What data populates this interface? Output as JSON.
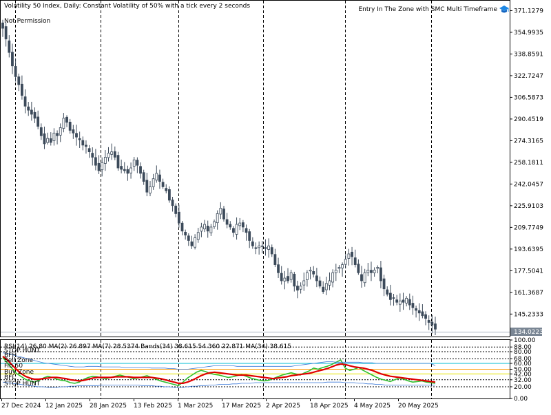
{
  "chart_title": "Volatility 50 Index, Daily:  Constant Volatility of 50% with a tick every 2 seconds",
  "permission_text": "Not Permission",
  "ea_name": "Entry In The Zone with SMC Multi Timeframe",
  "ea_icon": "graduation-cap-icon",
  "colors": {
    "candle": "#3c4a5a",
    "rsi_green": "#2fbf2f",
    "rsi_red": "#e00000",
    "band_blue": "#3a78d8",
    "zone_orange": "#ff9a00",
    "zone_yellow": "#e6e600",
    "level_cyan": "#00bcd4",
    "grid": "#000000"
  },
  "chart_data": [
    {
      "type": "candlestick",
      "y_ticks": [
        "371.1279",
        "354.9935",
        "338.8591",
        "322.7247",
        "306.5873",
        "290.4519",
        "274.3165",
        "258.1811",
        "242.0457",
        "225.9103",
        "209.7749",
        "193.6395",
        "177.5041",
        "161.3687",
        "145.2333"
      ],
      "current_price": "134.0223",
      "ylim": [
        129,
        377
      ],
      "x_labels": [
        "27 Dec 2024",
        "12 Jan 2025",
        "28 Jan 2025",
        "13 Feb 2025",
        "1 Mar 2025",
        "17 Mar 2025",
        "2 Apr 2025",
        "18 Apr 2025",
        "4 May 2025",
        "20 May 2025"
      ],
      "closes": [
        358,
        350,
        340,
        330,
        322,
        316,
        308,
        300,
        297,
        294,
        291,
        285,
        278,
        272,
        276,
        273,
        280,
        278,
        284,
        291,
        288,
        282,
        280,
        277,
        275,
        271,
        270,
        266,
        262,
        256,
        252,
        258,
        262,
        265,
        266,
        262,
        254,
        253,
        252,
        250,
        254,
        260,
        256,
        250,
        244,
        236,
        240,
        246,
        250,
        244,
        240,
        237,
        230,
        226,
        220,
        213,
        207,
        204,
        200,
        196,
        202,
        206,
        210,
        212,
        207,
        210,
        214,
        220,
        224,
        216,
        212,
        210,
        206,
        212,
        213,
        210,
        206,
        200,
        196,
        194,
        196,
        196,
        194,
        196,
        190,
        182,
        176,
        170,
        172,
        170,
        176,
        166,
        163,
        166,
        170,
        176,
        178,
        175,
        170,
        166,
        162,
        168,
        170,
        176,
        178,
        180,
        182,
        186,
        190,
        188,
        182,
        176,
        170,
        176,
        178,
        176,
        178,
        180,
        170,
        164,
        160,
        156,
        157,
        154,
        155,
        154,
        157,
        152,
        150,
        148,
        146,
        144,
        142,
        139,
        137,
        134
      ]
    },
    {
      "type": "line",
      "legend": "RSI(14) 26.80 MA(2) 26.897 MA(7) 28.5374 Bands(34) 38.615 54.360 22.871 MA(34) 38.615",
      "y_ticks": [
        "100.00",
        "88.00",
        "80.00",
        "68.00",
        "60.00",
        "50.00",
        "42.00",
        "32.00",
        "20.00",
        "0.00"
      ],
      "ylim": [
        0,
        100
      ],
      "zone_labels": [
        "STOP HUNT",
        "BFH",
        "Sell Zone",
        "Fib 50",
        "Buy Zone",
        "BFL",
        "STOP HUNT"
      ],
      "series": [
        {
          "values": [
            70,
            61,
            52,
            43,
            38,
            33,
            30,
            28,
            31,
            35,
            38,
            36,
            33,
            31,
            30,
            27,
            26,
            28,
            33,
            36,
            38,
            37,
            35,
            34,
            36,
            38,
            40,
            38,
            36,
            34,
            35,
            37,
            39,
            36,
            33,
            30,
            28,
            26,
            24,
            22,
            28,
            35,
            40,
            45,
            48,
            46,
            43,
            41,
            40,
            38,
            36,
            37,
            39,
            41,
            38,
            35,
            33,
            31,
            30,
            31,
            34,
            37,
            40,
            42,
            44,
            42,
            40,
            44,
            47,
            52,
            50,
            53,
            55,
            58,
            62,
            66,
            52,
            48,
            50,
            53,
            48,
            44,
            40,
            36,
            33,
            31,
            29,
            32,
            35,
            33,
            30,
            28,
            29,
            30,
            28,
            27,
            26
          ]
        },
        {
          "values": [
            72,
            66,
            58,
            50,
            43,
            38,
            35,
            33,
            33,
            34,
            35,
            36,
            36,
            35,
            34,
            32,
            31,
            30,
            31,
            33,
            35,
            36,
            36,
            36,
            36,
            37,
            37,
            37,
            37,
            36,
            36,
            36,
            36,
            36,
            35,
            34,
            32,
            30,
            28,
            26,
            26,
            28,
            31,
            35,
            39,
            42,
            44,
            45,
            44,
            43,
            42,
            41,
            40,
            40,
            40,
            39,
            38,
            37,
            36,
            35,
            34,
            35,
            36,
            37,
            39,
            40,
            41,
            42,
            43,
            45,
            47,
            49,
            51,
            54,
            57,
            59,
            58,
            56,
            54,
            53,
            52,
            50,
            48,
            45,
            42,
            40,
            38,
            37,
            36,
            35,
            34,
            33,
            32,
            31,
            30,
            29,
            28
          ]
        },
        {
          "values": [
            78,
            77,
            75,
            73,
            71,
            69,
            67,
            65,
            63,
            61,
            60,
            59,
            58,
            57,
            56,
            55,
            54,
            54,
            54,
            55,
            55,
            55,
            54,
            54,
            54,
            54,
            54,
            53,
            53,
            53,
            53,
            53,
            53,
            52,
            52,
            52,
            52,
            51,
            51,
            50,
            50,
            50,
            51,
            52,
            53,
            54,
            55,
            56,
            56,
            56,
            56,
            56,
            55,
            55,
            55,
            55,
            55,
            55,
            55,
            55,
            55,
            55,
            55,
            55,
            55,
            56,
            57,
            58,
            59,
            60,
            61,
            62,
            63,
            63,
            62,
            62,
            62,
            62,
            62,
            62,
            61,
            61,
            61,
            60,
            60,
            60,
            60,
            60,
            60,
            60,
            60,
            60,
            60,
            60,
            60,
            60,
            56
          ]
        },
        {
          "values": [
            28,
            27,
            26,
            25,
            24,
            23,
            22,
            21,
            20,
            20,
            19,
            19,
            19,
            20,
            20,
            21,
            21,
            22,
            22,
            22,
            22,
            22,
            23,
            23,
            23,
            23,
            23,
            23,
            23,
            23,
            23,
            22,
            22,
            22,
            21,
            21,
            20,
            20,
            19,
            19,
            19,
            20,
            21,
            21,
            22,
            22,
            23,
            23,
            24,
            24,
            24,
            25,
            25,
            26,
            26,
            26,
            27,
            27,
            27,
            27,
            27,
            27,
            27,
            27,
            27,
            27,
            27,
            27,
            27,
            27,
            27,
            27,
            28,
            28,
            28,
            28,
            27,
            27,
            27,
            26,
            26,
            25,
            25,
            24,
            24,
            23,
            23,
            23,
            23,
            23,
            23,
            23,
            23,
            23,
            23,
            23,
            23
          ]
        }
      ]
    }
  ]
}
